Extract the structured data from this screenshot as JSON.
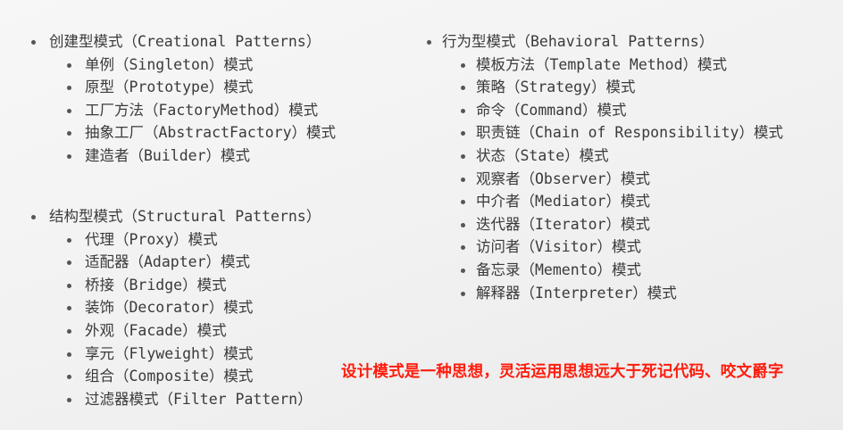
{
  "groups": [
    {
      "title": "创建型模式（Creational Patterns）",
      "items": [
        "单例（Singleton）模式",
        "原型（Prototype）模式",
        "工厂方法（FactoryMethod）模式",
        "抽象工厂（AbstractFactory）模式",
        "建造者（Builder）模式"
      ]
    },
    {
      "title": "结构型模式（Structural Patterns）",
      "items": [
        "代理（Proxy）模式",
        "适配器（Adapter）模式",
        "桥接（Bridge）模式",
        "装饰（Decorator）模式",
        "外观（Facade）模式",
        "享元（Flyweight）模式",
        "组合（Composite）模式",
        "过滤器模式（Filter Pattern）"
      ]
    },
    {
      "title": "行为型模式（Behavioral Patterns）",
      "items": [
        "模板方法（Template Method）模式",
        "策略（Strategy）模式",
        "命令（Command）模式",
        "职责链（Chain of Responsibility）模式",
        "状态（State）模式",
        "观察者（Observer）模式",
        "中介者（Mediator）模式",
        "迭代器（Iterator）模式",
        "访问者（Visitor）模式",
        "备忘录（Memento）模式",
        "解释器（Interpreter）模式"
      ]
    }
  ],
  "note": "设计模式是一种思想，灵活运用思想远大于死记代码、咬文爵字",
  "colors": {
    "note": "#ff1c0c",
    "text": "#3a3a3a"
  }
}
